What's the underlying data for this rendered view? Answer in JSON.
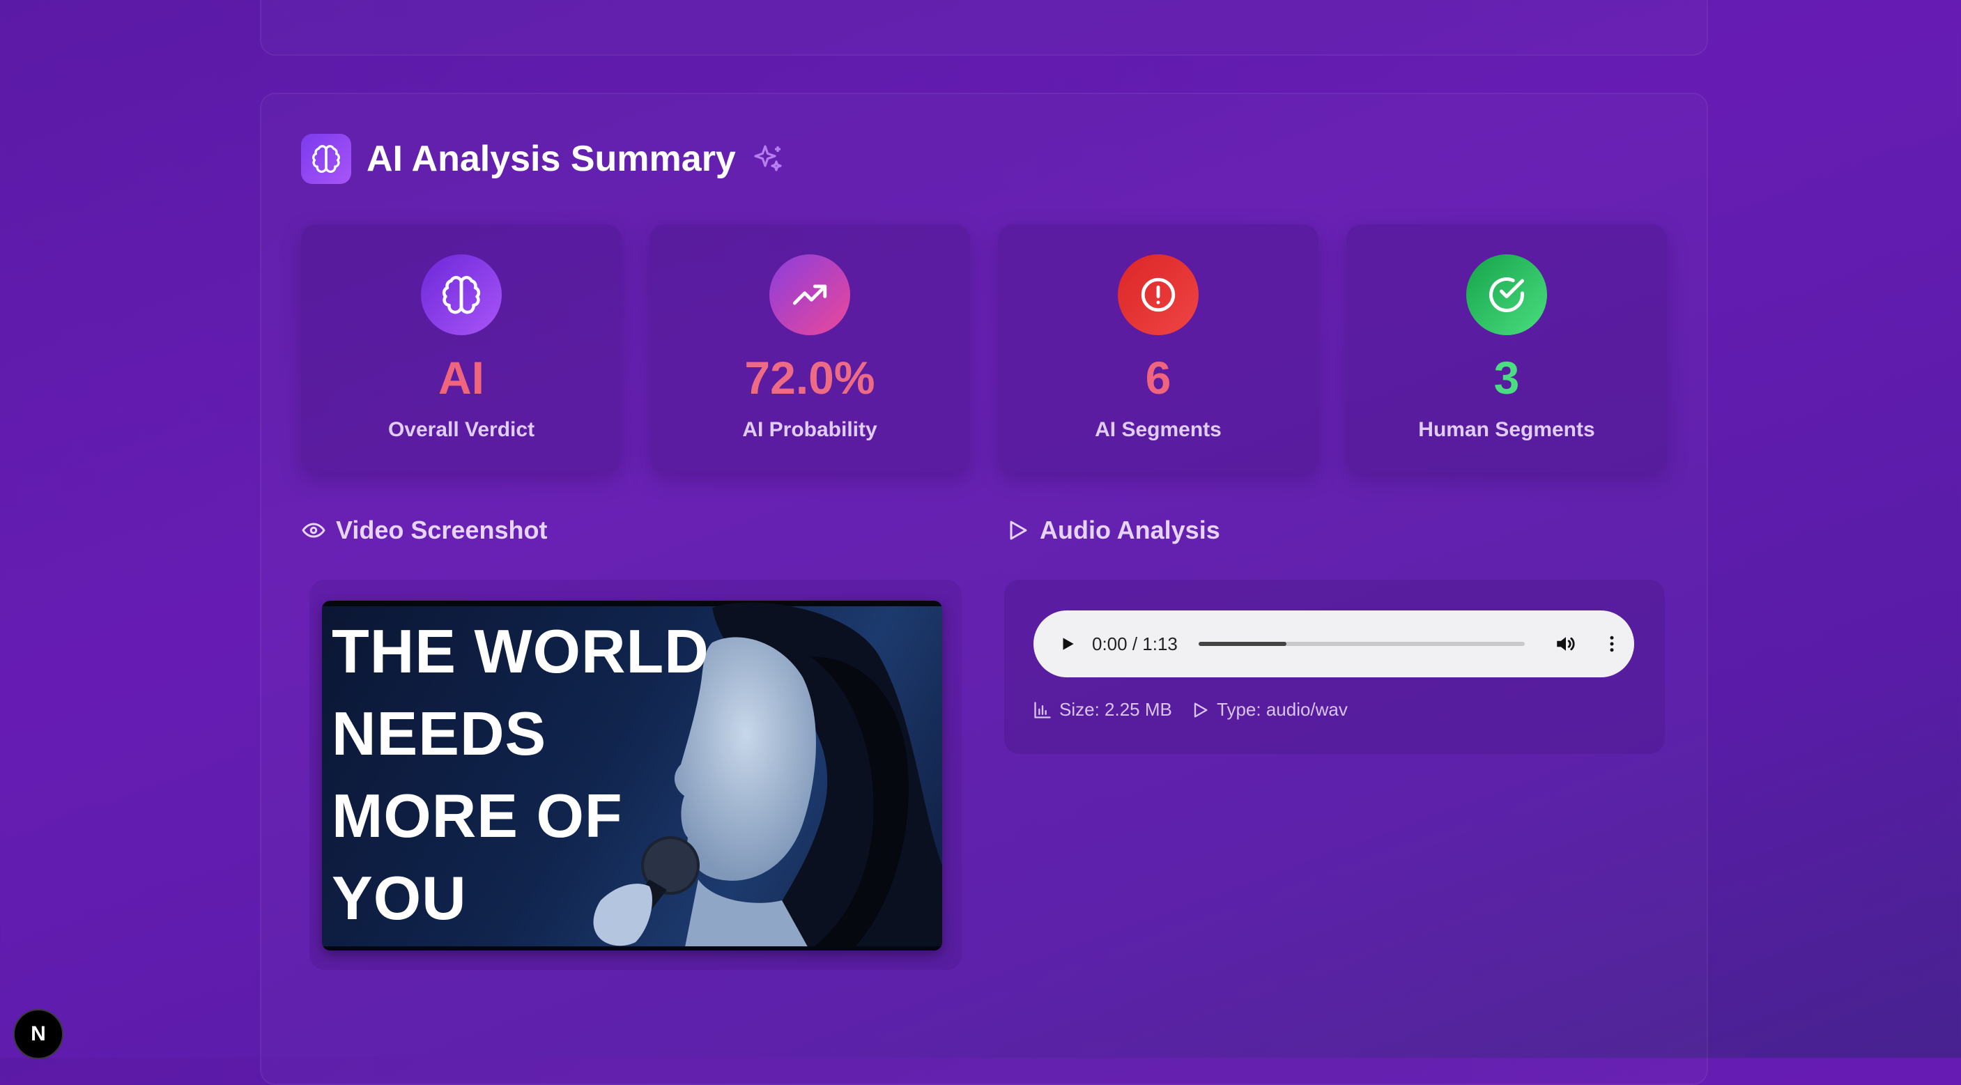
{
  "summary": {
    "title": "AI Analysis Summary"
  },
  "stats": [
    {
      "value": "AI",
      "label": "Overall Verdict",
      "icon": "brain-icon"
    },
    {
      "value": "72.0%",
      "label": "AI Probability",
      "icon": "trending-up-icon"
    },
    {
      "value": "6",
      "label": "AI Segments",
      "icon": "alert-circle-icon"
    },
    {
      "value": "3",
      "label": "Human Segments",
      "icon": "check-circle-icon"
    }
  ],
  "video": {
    "heading": "Video Screenshot",
    "overlay_lines": [
      "THE WORLD",
      "NEEDS",
      "MORE OF",
      "YOU"
    ]
  },
  "audio": {
    "heading": "Audio Analysis",
    "time_display": "0:00 / 1:13",
    "progress_fraction": 0.27,
    "size": "Size: 2.25 MB",
    "type": "Type: audio/wav"
  },
  "badge": {
    "letter": "N"
  },
  "colors": {
    "accent_purple": "#7c3aed",
    "verdict_red": "#f0657e",
    "human_green": "#4ade80",
    "alert_red": "#dc2626"
  }
}
